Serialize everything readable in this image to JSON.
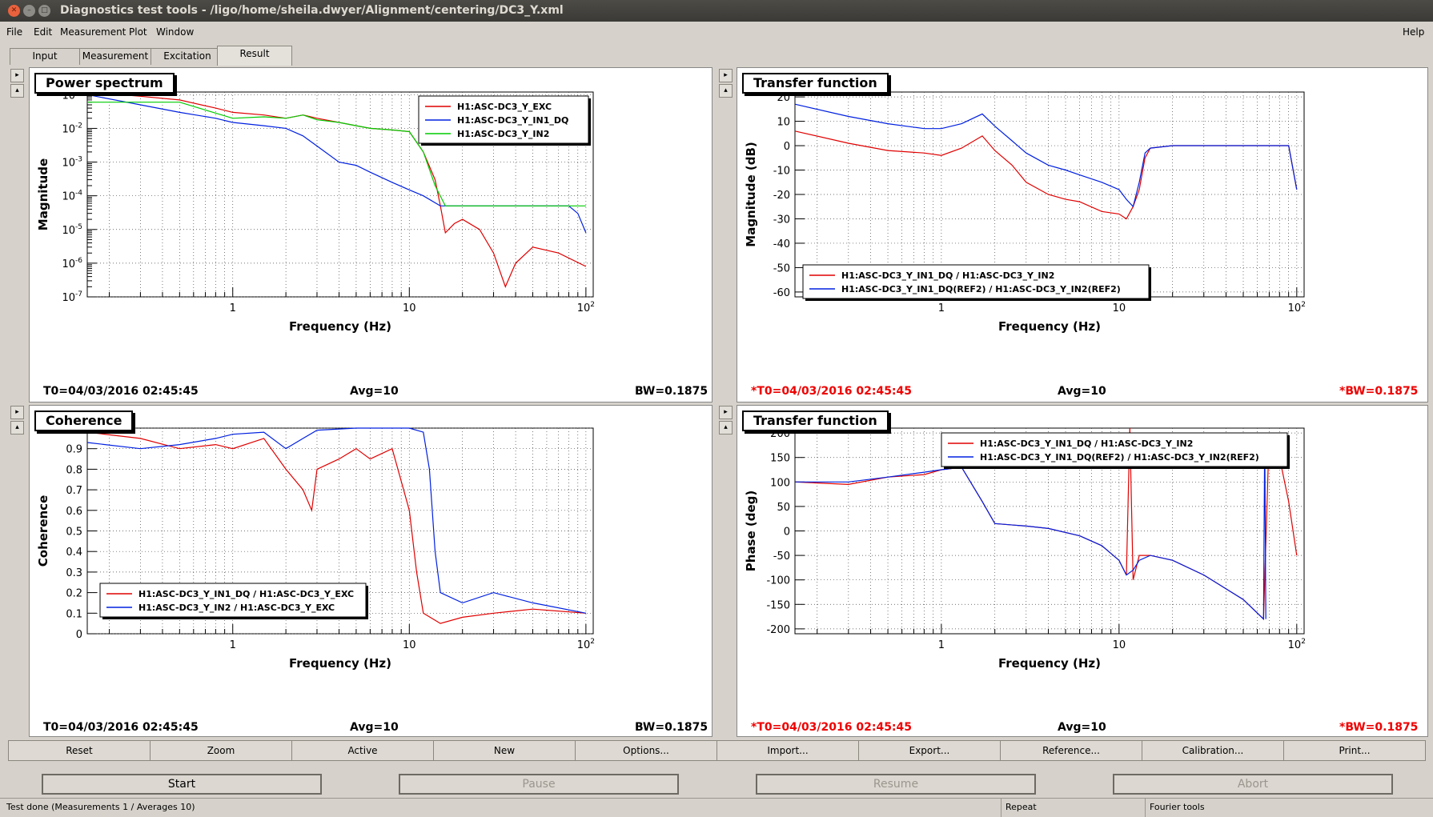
{
  "window": {
    "title": "Diagnostics test tools - /ligo/home/sheila.dwyer/Alignment/centering/DC3_Y.xml"
  },
  "menu": {
    "items": [
      "File",
      "Edit",
      "Measurement",
      "Plot",
      "Window"
    ],
    "help": "Help"
  },
  "tabs": [
    "Input",
    "Measurement",
    "Excitation",
    "Result"
  ],
  "active_tab": "Result",
  "panels": [
    {
      "title": "Power spectrum",
      "ylabel": "Magnitude",
      "xlabel": "Frequency (Hz)",
      "t0": "T0=04/03/2016 02:45:45",
      "avg": "Avg=10",
      "bw": "BW=0.1875",
      "reference": false,
      "yticks": [
        "10^-1",
        "10^-2",
        "10^-3",
        "10^-4",
        "10^-5",
        "10^-6",
        "10^-7"
      ],
      "xticks": [
        "1",
        "10",
        "10^2"
      ],
      "legend": [
        {
          "label": "H1:ASC-DC3_Y_EXC",
          "color": "#e00000"
        },
        {
          "label": "H1:ASC-DC3_Y_IN1_DQ",
          "color": "#0020e0"
        },
        {
          "label": "H1:ASC-DC3_Y_IN2",
          "color": "#00cc00"
        }
      ]
    },
    {
      "title": "Transfer function",
      "ylabel": "Magnitude (dB)",
      "xlabel": "Frequency (Hz)",
      "t0": "*T0=04/03/2016 02:45:45",
      "avg": "Avg=10",
      "bw": "*BW=0.1875",
      "reference": true,
      "yticks": [
        "20",
        "10",
        "0",
        "-10",
        "-20",
        "-30",
        "-40",
        "-50",
        "-60"
      ],
      "xticks": [
        "1",
        "10",
        "10^2"
      ],
      "legend": [
        {
          "label": "H1:ASC-DC3_Y_IN1_DQ / H1:ASC-DC3_Y_IN2",
          "color": "#e00000"
        },
        {
          "label": "H1:ASC-DC3_Y_IN1_DQ(REF2) / H1:ASC-DC3_Y_IN2(REF2)",
          "color": "#0020e0"
        }
      ]
    },
    {
      "title": "Coherence",
      "ylabel": "Coherence",
      "xlabel": "Frequency (Hz)",
      "t0": "T0=04/03/2016 02:45:45",
      "avg": "Avg=10",
      "bw": "BW=0.1875",
      "reference": false,
      "yticks": [
        "1",
        "0.9",
        "0.8",
        "0.7",
        "0.6",
        "0.5",
        "0.4",
        "0.3",
        "0.2",
        "0.1",
        "0"
      ],
      "xticks": [
        "1",
        "10",
        "10^2"
      ],
      "legend": [
        {
          "label": "H1:ASC-DC3_Y_IN1_DQ / H1:ASC-DC3_Y_EXC",
          "color": "#e00000"
        },
        {
          "label": "H1:ASC-DC3_Y_IN2 / H1:ASC-DC3_Y_EXC",
          "color": "#0020e0"
        }
      ]
    },
    {
      "title": "Transfer function",
      "ylabel": "Phase (deg)",
      "xlabel": "Frequency (Hz)",
      "t0": "*T0=04/03/2016 02:45:45",
      "avg": "Avg=10",
      "bw": "*BW=0.1875",
      "reference": true,
      "yticks": [
        "200",
        "150",
        "100",
        "50",
        "0",
        "-50",
        "-100",
        "-150",
        "-200"
      ],
      "xticks": [
        "1",
        "10",
        "10^2"
      ],
      "legend": [
        {
          "label": "H1:ASC-DC3_Y_IN1_DQ / H1:ASC-DC3_Y_IN2",
          "color": "#e00000"
        },
        {
          "label": "H1:ASC-DC3_Y_IN1_DQ(REF2) / H1:ASC-DC3_Y_IN2(REF2)",
          "color": "#0020e0"
        }
      ]
    }
  ],
  "chart_data": [
    {
      "type": "line",
      "title": "Power spectrum",
      "xlabel": "Frequency (Hz)",
      "ylabel": "Magnitude",
      "xscale": "log",
      "yscale": "log",
      "xlim": [
        0.15,
        110
      ],
      "ylim": [
        1e-07,
        0.12
      ],
      "legend": "top-right",
      "grid": true,
      "series": [
        {
          "name": "H1:ASC-DC3_Y_EXC",
          "color": "#e00000",
          "x": [
            0.15,
            0.3,
            0.5,
            0.8,
            1,
            1.5,
            2,
            2.5,
            3,
            4,
            5,
            6,
            8,
            10,
            12,
            14,
            15,
            16,
            18,
            20,
            25,
            30,
            35,
            40,
            50,
            70,
            100
          ],
          "y": [
            0.12,
            0.09,
            0.07,
            0.04,
            0.03,
            0.025,
            0.02,
            0.025,
            0.02,
            0.015,
            0.012,
            0.01,
            0.009,
            0.008,
            0.002,
            0.0003,
            5e-05,
            8e-06,
            1.5e-05,
            2e-05,
            1e-05,
            2e-06,
            2e-07,
            1e-06,
            3e-06,
            2e-06,
            8e-07
          ]
        },
        {
          "name": "H1:ASC-DC3_Y_IN1_DQ",
          "color": "#0020e0",
          "x": [
            0.15,
            0.3,
            0.5,
            0.8,
            1,
            1.5,
            2,
            2.5,
            3,
            4,
            5,
            6,
            8,
            10,
            12,
            15,
            20,
            30,
            50,
            80,
            90,
            100
          ],
          "y": [
            0.1,
            0.05,
            0.03,
            0.02,
            0.015,
            0.012,
            0.01,
            0.006,
            0.003,
            0.001,
            0.0008,
            0.0005,
            0.00025,
            0.00015,
            0.0001,
            5e-05,
            5e-05,
            5e-05,
            5e-05,
            5e-05,
            3e-05,
            8e-06
          ]
        },
        {
          "name": "H1:ASC-DC3_Y_IN2",
          "color": "#00cc00",
          "x": [
            0.15,
            0.5,
            1,
            1.5,
            2,
            2.5,
            3,
            4,
            5,
            6,
            8,
            10,
            12,
            14,
            16,
            20,
            50,
            100
          ],
          "y": [
            0.06,
            0.06,
            0.02,
            0.022,
            0.02,
            0.025,
            0.018,
            0.015,
            0.012,
            0.01,
            0.009,
            0.008,
            0.002,
            0.0002,
            5e-05,
            5e-05,
            5e-05,
            5e-05
          ]
        }
      ]
    },
    {
      "type": "line",
      "title": "Transfer function",
      "xlabel": "Frequency (Hz)",
      "ylabel": "Magnitude (dB)",
      "xscale": "log",
      "xlim": [
        0.15,
        110
      ],
      "ylim": [
        -62,
        22
      ],
      "legend": "bottom-left",
      "grid": true,
      "series": [
        {
          "name": "H1:ASC-DC3_Y_IN1_DQ / H1:ASC-DC3_Y_IN2",
          "color": "#e00000",
          "x": [
            0.15,
            0.3,
            0.5,
            0.8,
            1,
            1.3,
            1.7,
            2,
            2.5,
            3,
            4,
            5,
            6,
            8,
            10,
            11,
            12,
            13,
            14,
            15,
            20,
            50,
            90,
            100
          ],
          "y": [
            6,
            1,
            -2,
            -3,
            -4,
            -1,
            4,
            -2,
            -8,
            -15,
            -20,
            -22,
            -23,
            -27,
            -28,
            -30,
            -25,
            -18,
            -5,
            -1,
            0,
            0,
            0,
            -18
          ]
        },
        {
          "name": "H1:ASC-DC3_Y_IN1_DQ(REF2) / H1:ASC-DC3_Y_IN2(REF2)",
          "color": "#0020e0",
          "x": [
            0.15,
            0.3,
            0.5,
            0.8,
            1,
            1.3,
            1.7,
            2,
            2.5,
            3,
            4,
            5,
            6,
            8,
            10,
            11,
            12,
            13,
            14,
            15,
            20,
            50,
            90,
            100
          ],
          "y": [
            17,
            12,
            9,
            7,
            7,
            9,
            13,
            8,
            2,
            -3,
            -8,
            -10,
            -12,
            -15,
            -18,
            -22,
            -25,
            -15,
            -3,
            -1,
            0,
            0,
            0,
            -18
          ]
        }
      ]
    },
    {
      "type": "line",
      "title": "Coherence",
      "xlabel": "Frequency (Hz)",
      "ylabel": "Coherence",
      "xscale": "log",
      "xlim": [
        0.15,
        110
      ],
      "ylim": [
        0,
        1
      ],
      "legend": "bottom-left",
      "grid": true,
      "series": [
        {
          "name": "H1:ASC-DC3_Y_IN1_DQ / H1:ASC-DC3_Y_EXC",
          "color": "#e00000",
          "x": [
            0.15,
            0.3,
            0.5,
            0.8,
            1,
            1.5,
            2,
            2.5,
            2.8,
            3,
            4,
            5,
            6,
            8,
            10,
            11,
            12,
            15,
            20,
            30,
            50,
            100
          ],
          "y": [
            0.98,
            0.95,
            0.9,
            0.92,
            0.9,
            0.95,
            0.8,
            0.7,
            0.6,
            0.8,
            0.85,
            0.9,
            0.85,
            0.9,
            0.6,
            0.3,
            0.1,
            0.05,
            0.08,
            0.1,
            0.12,
            0.1
          ]
        },
        {
          "name": "H1:ASC-DC3_Y_IN2 / H1:ASC-DC3_Y_EXC",
          "color": "#0020e0",
          "x": [
            0.15,
            0.3,
            0.5,
            0.8,
            1,
            1.5,
            2,
            2.5,
            3,
            5,
            10,
            12,
            13,
            14,
            15,
            20,
            30,
            50,
            100
          ],
          "y": [
            0.93,
            0.9,
            0.92,
            0.95,
            0.97,
            0.98,
            0.9,
            0.95,
            0.99,
            1,
            1,
            0.98,
            0.8,
            0.4,
            0.2,
            0.15,
            0.2,
            0.15,
            0.1
          ]
        }
      ]
    },
    {
      "type": "line",
      "title": "Transfer function",
      "xlabel": "Frequency (Hz)",
      "ylabel": "Phase (deg)",
      "xscale": "log",
      "xlim": [
        0.15,
        110
      ],
      "ylim": [
        -210,
        210
      ],
      "legend": "top-right",
      "grid": true,
      "series": [
        {
          "name": "H1:ASC-DC3_Y_IN1_DQ / H1:ASC-DC3_Y_IN2",
          "color": "#e00000",
          "x": [
            0.15,
            0.3,
            0.5,
            0.8,
            1,
            1.3,
            1.7,
            2,
            3,
            4,
            6,
            8,
            10,
            11,
            11.5,
            12,
            13,
            15,
            20,
            30,
            50,
            65,
            70,
            80,
            90,
            100
          ],
          "y": [
            100,
            95,
            110,
            115,
            125,
            130,
            60,
            15,
            10,
            5,
            -10,
            -30,
            -60,
            -90,
            210,
            -100,
            -50,
            -50,
            -60,
            -90,
            -140,
            -180,
            200,
            150,
            60,
            -50
          ]
        },
        {
          "name": "H1:ASC-DC3_Y_IN1_DQ(REF2) / H1:ASC-DC3_Y_IN2(REF2)",
          "color": "#0020e0",
          "x": [
            0.15,
            0.3,
            0.5,
            0.8,
            1,
            1.3,
            1.7,
            2,
            3,
            4,
            6,
            8,
            10,
            11,
            12,
            13,
            15,
            20,
            30,
            50,
            65,
            66,
            67
          ],
          "y": [
            100,
            100,
            110,
            120,
            125,
            130,
            60,
            15,
            10,
            5,
            -10,
            -30,
            -60,
            -90,
            -80,
            -60,
            -50,
            -60,
            -90,
            -140,
            -180,
            200,
            -180
          ]
        }
      ]
    }
  ],
  "toolbar": [
    "Reset",
    "Zoom",
    "Active",
    "New",
    "Options...",
    "Import...",
    "Export...",
    "Reference...",
    "Calibration...",
    "Print..."
  ],
  "actions": {
    "start": "Start",
    "pause": "Pause",
    "resume": "Resume",
    "abort": "Abort"
  },
  "status": {
    "message": "Test done (Measurements 1 / Averages 10)",
    "mode": "Repeat",
    "tool": "Fourier tools"
  }
}
